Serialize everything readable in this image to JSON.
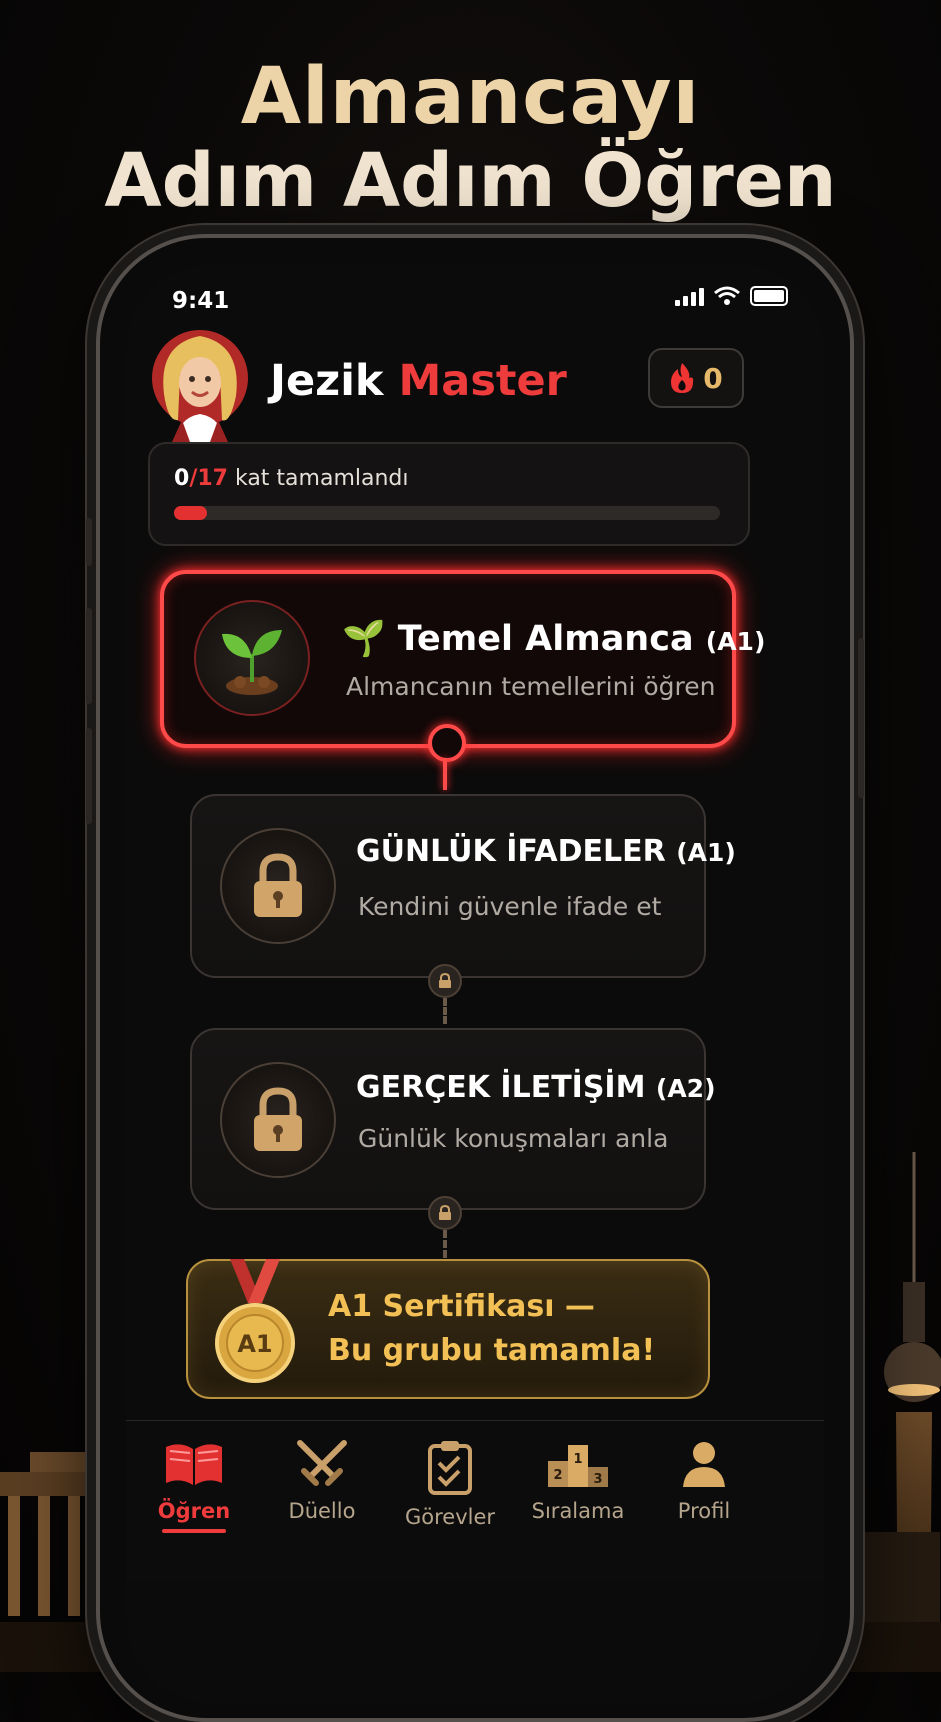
{
  "headline": {
    "line1": "Almancayı",
    "line2": "Adım Adım Öğren"
  },
  "status_bar": {
    "time": "9:41"
  },
  "header": {
    "brand_first": "Jezik",
    "brand_second": "Master",
    "streak_count": "0"
  },
  "progress": {
    "completed": "0",
    "total": "/17",
    "label": "kat tamamlandı",
    "fraction": 0.06
  },
  "levels": [
    {
      "emoji": "🌱",
      "title": "Temel Almanca",
      "level": "(A1)",
      "subtitle": "Almancanın temellerini öğren",
      "state": "active"
    },
    {
      "title": "GÜNLÜK İFADELER",
      "level": "(A1)",
      "subtitle": "Kendini güvenle ifade et",
      "state": "locked"
    },
    {
      "title": "GERÇEK İLETİŞİM",
      "level": "(A2)",
      "subtitle": "Günlük konuşmaları anla",
      "state": "locked"
    }
  ],
  "certificate": {
    "badge": "A1",
    "line1": "A1 Sertifikası —",
    "line2": "Bu grubu tamamla!"
  },
  "tabs": [
    {
      "label": "Öğren",
      "icon": "book-icon",
      "active": true
    },
    {
      "label": "Düello",
      "icon": "swords-icon",
      "active": false
    },
    {
      "label": "Görevler",
      "icon": "clipboard-icon",
      "active": false
    },
    {
      "label": "Sıralama",
      "icon": "podium-icon",
      "active": false
    },
    {
      "label": "Profil",
      "icon": "user-icon",
      "active": false
    }
  ],
  "podium_numbers": [
    "2",
    "1",
    "3"
  ],
  "colors": {
    "accent_red": "#ee3b3b",
    "gold": "#f2c055",
    "background": "#0c0b0b"
  }
}
